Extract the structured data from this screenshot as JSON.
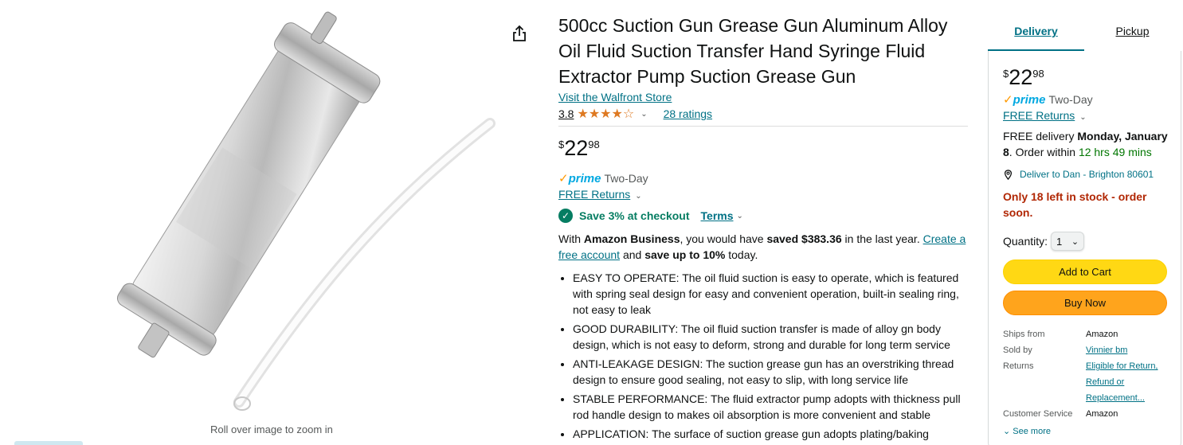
{
  "product": {
    "title": "500cc Suction Gun Grease Gun Aluminum Alloy Oil Fluid Suction Transfer Hand Syringe Fluid Extractor Pump Suction Grease Gun",
    "store_link": "Visit the Walfront Store",
    "rating_value": "3.8",
    "rating_stars": 3.8,
    "rating_stars_text": "★★★★☆",
    "ratings_count": "28 ratings",
    "zoom_hint": "Roll over image to zoom in"
  },
  "price": {
    "symbol": "$",
    "whole": "22",
    "fraction": "98"
  },
  "prime": {
    "check": "✓",
    "word": "prime",
    "label": "Two-Day",
    "returns": "FREE Returns"
  },
  "savings": {
    "text": "Save 3% at checkout",
    "terms": "Terms"
  },
  "business": {
    "prefix": "With ",
    "brand": "Amazon Business",
    "mid1": ", you would have ",
    "saved": "saved $383.36",
    "mid2": " in the last year. ",
    "link": "Create a free account",
    "mid3": " and ",
    "upto": "save up to 10%",
    "suffix": " today."
  },
  "bullets": [
    "EASY TO OPERATE: The oil fluid suction is easy to operate, which is featured with spring seal design for easy and convenient operation, built-in sealing ring, not easy to leak",
    "GOOD DURABILITY: The oil fluid suction transfer is made of alloy gn body design, which is not easy to deform, strong and durable for long term service",
    "ANTI-LEAKAGE DESIGN: The suction grease gun has an overstriking thread design to ensure good sealing, not easy to slip, with long service life",
    "STABLE PERFORMANCE: The fluid extractor pump adopts with thickness pull rod handle design to makes oil absorption is more convenient and stable",
    "APPLICATION: The surface of suction grease gun adopts plating/baking"
  ],
  "buybox": {
    "tabs": [
      "Delivery",
      "Pickup"
    ],
    "delivery_prefix": "FREE delivery ",
    "delivery_date": "Monday, January 8",
    "delivery_mid": ". Order within ",
    "delivery_countdown": "12 hrs 49 mins",
    "deliver_to": "Deliver to Dan - Brighton 80601",
    "stock": "Only 18 left in stock - order soon.",
    "quantity_label": "Quantity:",
    "quantity_value": "1",
    "add_to_cart": "Add to Cart",
    "buy_now": "Buy Now",
    "info": [
      {
        "label": "Ships from",
        "value": "Amazon"
      },
      {
        "label": "Sold by",
        "value": "Vinnier bm"
      },
      {
        "label": "Returns",
        "value": "Eligible for Return, Refund or Replacement..."
      },
      {
        "label": "Customer Service",
        "value": "Amazon"
      }
    ],
    "see_more": "See more"
  },
  "colors": {
    "link": "#007185",
    "prime_blue": "#00a8e1",
    "add_to_cart": "#ffd814",
    "buy_now": "#ffa41c",
    "stock_red": "#b12704",
    "success_green": "#067d62"
  }
}
